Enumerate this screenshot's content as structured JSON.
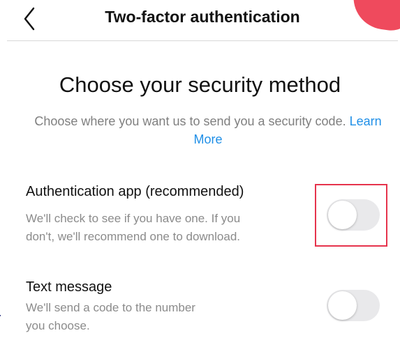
{
  "header": {
    "title": "Two-factor authentication",
    "back_icon": "chevron-left-icon"
  },
  "main": {
    "title": "Choose your security method",
    "subtitle_prefix": "Choose where you want us to send you a security code.",
    "learn_more": "Learn More"
  },
  "options": [
    {
      "title": "Authentication app (recommended)",
      "description_line1": "We'll check to see if you have one. If you",
      "description_line2": "don't, we'll recommend one to download.",
      "enabled": false
    },
    {
      "title": "Text message",
      "description_line1": "We'll send a code to the number",
      "description_line2": "you choose.",
      "enabled": false
    }
  ],
  "edge_text": "r",
  "colors": {
    "accent_link": "#1f8fe7",
    "highlight": "#e6334c",
    "corner_blob": "#ef4a5d",
    "toggle_off": "#e9e9eb"
  }
}
